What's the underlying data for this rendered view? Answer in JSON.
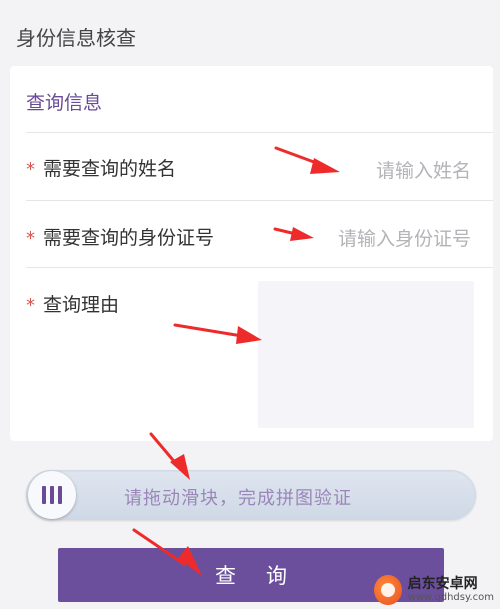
{
  "page": {
    "title": "身份信息核查"
  },
  "form": {
    "section_title": "查询信息",
    "required_mark": "*",
    "fields": [
      {
        "label": "需要查询的姓名",
        "placeholder": "请输入姓名"
      },
      {
        "label": "需要查询的身份证号",
        "placeholder": "请输入身份证号"
      },
      {
        "label": "查询理由",
        "placeholder": ""
      }
    ]
  },
  "slider": {
    "label": "请拖动滑块，完成拼图验证",
    "progress": 0
  },
  "submit": {
    "label": "查询"
  },
  "watermark": {
    "title": "启东安卓网",
    "url": "www.qdhdsy.com"
  },
  "colors": {
    "accent": "#6b4f9c",
    "arrow": "#ee2b2b",
    "required": "#d9534f"
  }
}
